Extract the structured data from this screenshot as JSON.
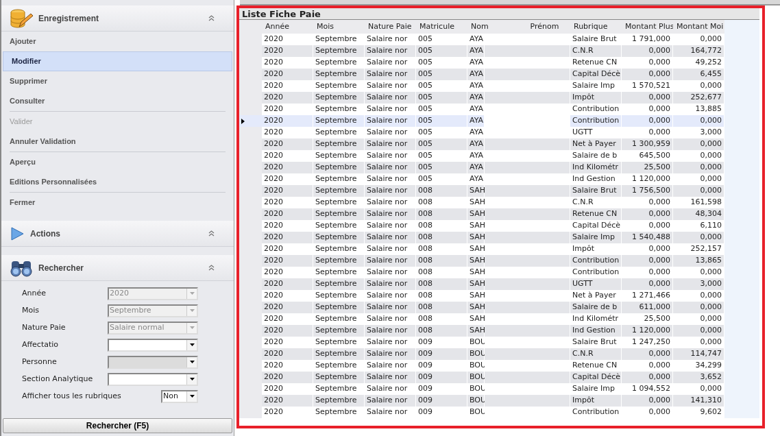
{
  "sidebar": {
    "sections": [
      {
        "title": "Enregistrement",
        "expanded": true,
        "groups": [
          [
            {
              "label": "Ajouter",
              "selected": false,
              "disabled": false
            },
            {
              "label": "Modifier",
              "selected": true,
              "disabled": false
            },
            {
              "label": "Supprimer",
              "selected": false,
              "disabled": false
            },
            {
              "label": "Consulter",
              "selected": false,
              "disabled": false
            }
          ],
          [
            {
              "label": "Valider",
              "selected": false,
              "disabled": true
            },
            {
              "label": "Annuler Validation",
              "selected": false,
              "disabled": false
            }
          ],
          [
            {
              "label": "Aperçu",
              "selected": false,
              "disabled": false
            },
            {
              "label": "Editions Personnalisées",
              "selected": false,
              "disabled": false
            }
          ],
          [
            {
              "label": "Fermer",
              "selected": false,
              "disabled": false
            }
          ]
        ]
      },
      {
        "title": "Actions",
        "expanded": true
      },
      {
        "title": "Rechercher",
        "expanded": true
      }
    ],
    "search_form": {
      "fields": [
        {
          "label": "Année",
          "value": "2020",
          "disabled": true,
          "readonly": false,
          "kind": "wide"
        },
        {
          "label": "Mois",
          "value": "Septembre",
          "disabled": true,
          "readonly": false,
          "kind": "wide"
        },
        {
          "label": "Nature Paie",
          "value": "Salaire normal",
          "disabled": true,
          "readonly": false,
          "kind": "wide"
        },
        {
          "label": "Affectatio",
          "disabled": false,
          "readonly": false,
          "kind": "wide"
        },
        {
          "label": "Personne",
          "disabled": false,
          "readonly": true,
          "kind": "wide"
        },
        {
          "label": "Section Analytique",
          "disabled": false,
          "readonly": false,
          "kind": "wide"
        },
        {
          "label": "Afficher tous les rubriques",
          "value": "Non",
          "disabled": false,
          "readonly": false,
          "kind": "small"
        }
      ],
      "button": "Rechercher (F5)"
    }
  },
  "grid": {
    "title": "Liste Fiche Paie",
    "columns": [
      "Année",
      "Mois",
      "Nature Paie",
      "Matricule",
      "Nom",
      "Prénom",
      "Rubrique",
      "Montant Plus",
      "Montant Moi"
    ],
    "rows": [
      {
        "selected": false,
        "cells": [
          "2020",
          "Septembre",
          "Salaire nor",
          "005",
          "AYA",
          "",
          "Salaire Brut",
          "1 791,000",
          "0,000"
        ]
      },
      {
        "selected": false,
        "cells": [
          "2020",
          "Septembre",
          "Salaire nor",
          "005",
          "AYA",
          "",
          "C.N.R",
          "0,000",
          "164,772"
        ]
      },
      {
        "selected": false,
        "cells": [
          "2020",
          "Septembre",
          "Salaire nor",
          "005",
          "AYA",
          "",
          "Retenue CN",
          "0,000",
          "49,252"
        ]
      },
      {
        "selected": false,
        "cells": [
          "2020",
          "Septembre",
          "Salaire nor",
          "005",
          "AYA",
          "",
          "Capital Décè",
          "0,000",
          "6,455"
        ]
      },
      {
        "selected": false,
        "cells": [
          "2020",
          "Septembre",
          "Salaire nor",
          "005",
          "AYA",
          "",
          "Salaire Imp",
          "1 570,521",
          "0,000"
        ]
      },
      {
        "selected": false,
        "cells": [
          "2020",
          "Septembre",
          "Salaire nor",
          "005",
          "AYA",
          "",
          "Impôt",
          "0,000",
          "252,677"
        ]
      },
      {
        "selected": false,
        "cells": [
          "2020",
          "Septembre",
          "Salaire nor",
          "005",
          "AYA",
          "",
          "Contribution",
          "0,000",
          "13,885"
        ]
      },
      {
        "selected": true,
        "cells": [
          "2020",
          "Septembre",
          "Salaire nor",
          "005",
          "AYA",
          "",
          "Contribution",
          "0,000",
          "0,000"
        ]
      },
      {
        "selected": false,
        "cells": [
          "2020",
          "Septembre",
          "Salaire nor",
          "005",
          "AYA",
          "",
          "UGTT",
          "0,000",
          "3,000"
        ]
      },
      {
        "selected": false,
        "cells": [
          "2020",
          "Septembre",
          "Salaire nor",
          "005",
          "AYA",
          "",
          "Net à Payer",
          "1 300,959",
          "0,000"
        ]
      },
      {
        "selected": false,
        "cells": [
          "2020",
          "Septembre",
          "Salaire nor",
          "005",
          "AYA",
          "",
          "Salaire de b",
          "645,500",
          "0,000"
        ]
      },
      {
        "selected": false,
        "cells": [
          "2020",
          "Septembre",
          "Salaire nor",
          "005",
          "AYA",
          "",
          "Ind Kilométr",
          "25,500",
          "0,000"
        ]
      },
      {
        "selected": false,
        "cells": [
          "2020",
          "Septembre",
          "Salaire nor",
          "005",
          "AYA",
          "",
          "Ind Gestion",
          "1 120,000",
          "0,000"
        ]
      },
      {
        "selected": false,
        "cells": [
          "2020",
          "Septembre",
          "Salaire nor",
          "008",
          "SAH",
          "",
          "Salaire Brut",
          "1 756,500",
          "0,000"
        ]
      },
      {
        "selected": false,
        "cells": [
          "2020",
          "Septembre",
          "Salaire nor",
          "008",
          "SAH",
          "",
          "C.N.R",
          "0,000",
          "161,598"
        ]
      },
      {
        "selected": false,
        "cells": [
          "2020",
          "Septembre",
          "Salaire nor",
          "008",
          "SAH",
          "",
          "Retenue CN",
          "0,000",
          "48,304"
        ]
      },
      {
        "selected": false,
        "cells": [
          "2020",
          "Septembre",
          "Salaire nor",
          "008",
          "SAH",
          "",
          "Capital Décè",
          "0,000",
          "6,110"
        ]
      },
      {
        "selected": false,
        "cells": [
          "2020",
          "Septembre",
          "Salaire nor",
          "008",
          "SAH",
          "",
          "Salaire Imp",
          "1 540,488",
          "0,000"
        ]
      },
      {
        "selected": false,
        "cells": [
          "2020",
          "Septembre",
          "Salaire nor",
          "008",
          "SAH",
          "",
          "Impôt",
          "0,000",
          "252,157"
        ]
      },
      {
        "selected": false,
        "cells": [
          "2020",
          "Septembre",
          "Salaire nor",
          "008",
          "SAH",
          "",
          "Contribution",
          "0,000",
          "13,865"
        ]
      },
      {
        "selected": false,
        "cells": [
          "2020",
          "Septembre",
          "Salaire nor",
          "008",
          "SAH",
          "",
          "Contribution",
          "0,000",
          "0,000"
        ]
      },
      {
        "selected": false,
        "cells": [
          "2020",
          "Septembre",
          "Salaire nor",
          "008",
          "SAH",
          "",
          "UGTT",
          "0,000",
          "3,000"
        ]
      },
      {
        "selected": false,
        "cells": [
          "2020",
          "Septembre",
          "Salaire nor",
          "008",
          "SAH",
          "",
          "Net à Payer",
          "1 271,466",
          "0,000"
        ]
      },
      {
        "selected": false,
        "cells": [
          "2020",
          "Septembre",
          "Salaire nor",
          "008",
          "SAH",
          "",
          "Salaire de b",
          "611,000",
          "0,000"
        ]
      },
      {
        "selected": false,
        "cells": [
          "2020",
          "Septembre",
          "Salaire nor",
          "008",
          "SAH",
          "",
          "Ind Kilométr",
          "25,500",
          "0,000"
        ]
      },
      {
        "selected": false,
        "cells": [
          "2020",
          "Septembre",
          "Salaire nor",
          "008",
          "SAH",
          "",
          "Ind Gestion",
          "1 120,000",
          "0,000"
        ]
      },
      {
        "selected": false,
        "cells": [
          "2020",
          "Septembre",
          "Salaire nor",
          "009",
          "BOU",
          "",
          "Salaire Brut",
          "1 247,250",
          "0,000"
        ]
      },
      {
        "selected": false,
        "cells": [
          "2020",
          "Septembre",
          "Salaire nor",
          "009",
          "BOU",
          "",
          "C.N.R",
          "0,000",
          "114,747"
        ]
      },
      {
        "selected": false,
        "cells": [
          "2020",
          "Septembre",
          "Salaire nor",
          "009",
          "BOU",
          "",
          "Retenue CN",
          "0,000",
          "34,299"
        ]
      },
      {
        "selected": false,
        "cells": [
          "2020",
          "Septembre",
          "Salaire nor",
          "009",
          "BOU",
          "",
          "Capital Décè",
          "0,000",
          "3,652"
        ]
      },
      {
        "selected": false,
        "cells": [
          "2020",
          "Septembre",
          "Salaire nor",
          "009",
          "BOU",
          "",
          "Salaire Imp",
          "1 094,552",
          "0,000"
        ]
      },
      {
        "selected": false,
        "cells": [
          "2020",
          "Septembre",
          "Salaire nor",
          "009",
          "BOU",
          "",
          "Impôt",
          "0,000",
          "141,310"
        ]
      },
      {
        "selected": false,
        "cells": [
          "2020",
          "Septembre",
          "Salaire nor",
          "009",
          "BOU",
          "",
          "Contribution",
          "0,000",
          "9,602"
        ]
      }
    ]
  }
}
